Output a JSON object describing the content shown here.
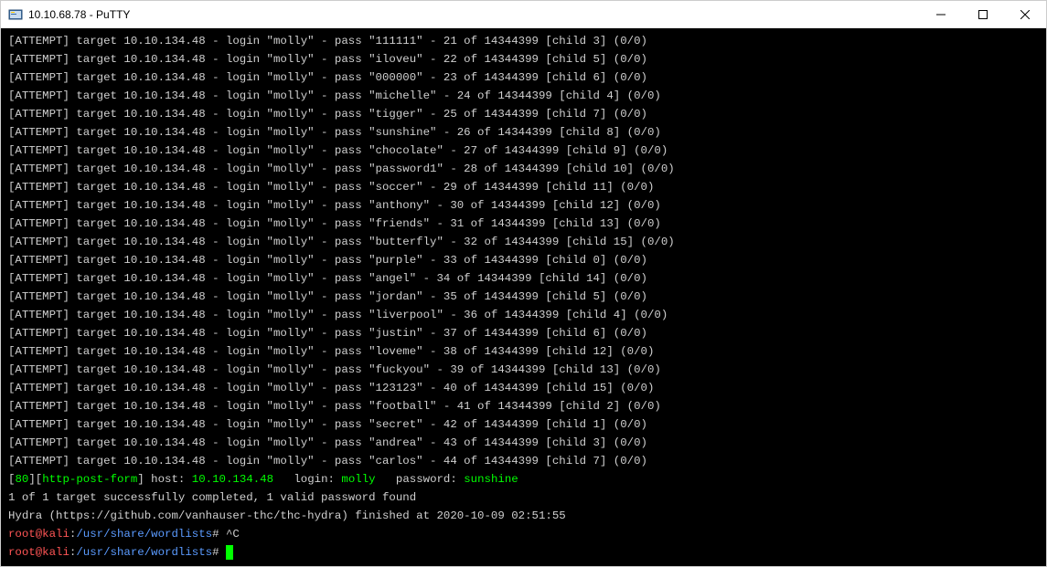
{
  "window": {
    "title": "10.10.68.78 - PuTTY"
  },
  "attempts": [
    {
      "target": "10.10.134.48",
      "login": "molly",
      "pass": "111111",
      "idx": 21,
      "total": 14344399,
      "child": 3
    },
    {
      "target": "10.10.134.48",
      "login": "molly",
      "pass": "iloveu",
      "idx": 22,
      "total": 14344399,
      "child": 5
    },
    {
      "target": "10.10.134.48",
      "login": "molly",
      "pass": "000000",
      "idx": 23,
      "total": 14344399,
      "child": 6
    },
    {
      "target": "10.10.134.48",
      "login": "molly",
      "pass": "michelle",
      "idx": 24,
      "total": 14344399,
      "child": 4
    },
    {
      "target": "10.10.134.48",
      "login": "molly",
      "pass": "tigger",
      "idx": 25,
      "total": 14344399,
      "child": 7
    },
    {
      "target": "10.10.134.48",
      "login": "molly",
      "pass": "sunshine",
      "idx": 26,
      "total": 14344399,
      "child": 8
    },
    {
      "target": "10.10.134.48",
      "login": "molly",
      "pass": "chocolate",
      "idx": 27,
      "total": 14344399,
      "child": 9
    },
    {
      "target": "10.10.134.48",
      "login": "molly",
      "pass": "password1",
      "idx": 28,
      "total": 14344399,
      "child": 10
    },
    {
      "target": "10.10.134.48",
      "login": "molly",
      "pass": "soccer",
      "idx": 29,
      "total": 14344399,
      "child": 11
    },
    {
      "target": "10.10.134.48",
      "login": "molly",
      "pass": "anthony",
      "idx": 30,
      "total": 14344399,
      "child": 12
    },
    {
      "target": "10.10.134.48",
      "login": "molly",
      "pass": "friends",
      "idx": 31,
      "total": 14344399,
      "child": 13
    },
    {
      "target": "10.10.134.48",
      "login": "molly",
      "pass": "butterfly",
      "idx": 32,
      "total": 14344399,
      "child": 15
    },
    {
      "target": "10.10.134.48",
      "login": "molly",
      "pass": "purple",
      "idx": 33,
      "total": 14344399,
      "child": 0
    },
    {
      "target": "10.10.134.48",
      "login": "molly",
      "pass": "angel",
      "idx": 34,
      "total": 14344399,
      "child": 14
    },
    {
      "target": "10.10.134.48",
      "login": "molly",
      "pass": "jordan",
      "idx": 35,
      "total": 14344399,
      "child": 5
    },
    {
      "target": "10.10.134.48",
      "login": "molly",
      "pass": "liverpool",
      "idx": 36,
      "total": 14344399,
      "child": 4
    },
    {
      "target": "10.10.134.48",
      "login": "molly",
      "pass": "justin",
      "idx": 37,
      "total": 14344399,
      "child": 6
    },
    {
      "target": "10.10.134.48",
      "login": "molly",
      "pass": "loveme",
      "idx": 38,
      "total": 14344399,
      "child": 12
    },
    {
      "target": "10.10.134.48",
      "login": "molly",
      "pass": "fuckyou",
      "idx": 39,
      "total": 14344399,
      "child": 13
    },
    {
      "target": "10.10.134.48",
      "login": "molly",
      "pass": "123123",
      "idx": 40,
      "total": 14344399,
      "child": 15
    },
    {
      "target": "10.10.134.48",
      "login": "molly",
      "pass": "football",
      "idx": 41,
      "total": 14344399,
      "child": 2
    },
    {
      "target": "10.10.134.48",
      "login": "molly",
      "pass": "secret",
      "idx": 42,
      "total": 14344399,
      "child": 1
    },
    {
      "target": "10.10.134.48",
      "login": "molly",
      "pass": "andrea",
      "idx": 43,
      "total": 14344399,
      "child": 3
    },
    {
      "target": "10.10.134.48",
      "login": "molly",
      "pass": "carlos",
      "idx": 44,
      "total": 14344399,
      "child": 7
    }
  ],
  "result": {
    "port": "80",
    "service": "http-post-form",
    "host_label": "host:",
    "host": "10.10.134.48",
    "login_label": "login:",
    "login": "molly",
    "password_label": "password:",
    "password": "sunshine"
  },
  "summary": "1 of 1 target successfully completed, 1 valid password found",
  "finish": "Hydra (https://github.com/vanhauser-thc/thc-hydra) finished at 2020-10-09 02:51:55",
  "prompt": {
    "user_host": "root@kali",
    "sep1": ":",
    "path": "/usr/share/wordlists",
    "sep2": "#",
    "interrupt": "^C"
  }
}
